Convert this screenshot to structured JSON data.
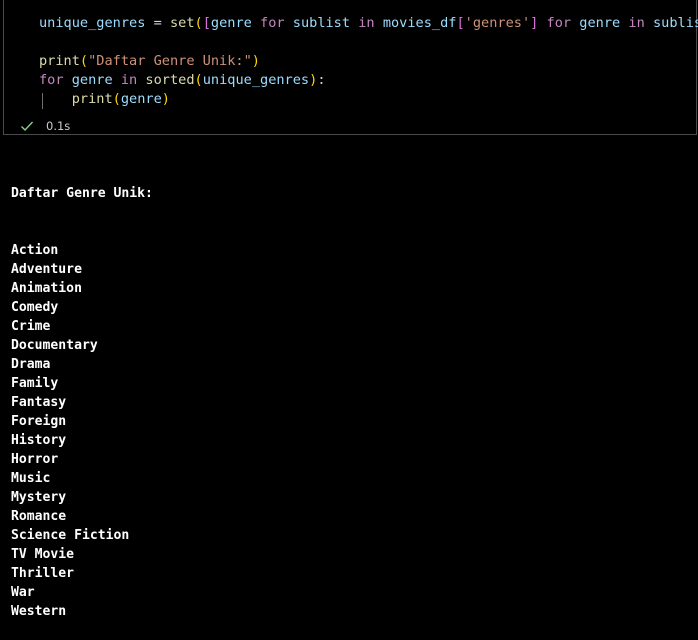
{
  "cell": {
    "code_lines": [
      [
        {
          "t": "unique_genres",
          "c": "var"
        },
        {
          "t": " = ",
          "c": "op"
        },
        {
          "t": "set",
          "c": "fn"
        },
        {
          "t": "(",
          "c": "br1"
        },
        {
          "t": "[",
          "c": "br2"
        },
        {
          "t": "genre",
          "c": "var"
        },
        {
          "t": " ",
          "c": "op"
        },
        {
          "t": "for",
          "c": "kw"
        },
        {
          "t": " ",
          "c": "op"
        },
        {
          "t": "sublist",
          "c": "var"
        },
        {
          "t": " ",
          "c": "op"
        },
        {
          "t": "in",
          "c": "kw"
        },
        {
          "t": " ",
          "c": "op"
        },
        {
          "t": "movies_df",
          "c": "var"
        },
        {
          "t": "[",
          "c": "br2"
        },
        {
          "t": "'genres'",
          "c": "str"
        },
        {
          "t": "]",
          "c": "br2"
        },
        {
          "t": " ",
          "c": "op"
        },
        {
          "t": "for",
          "c": "kw"
        },
        {
          "t": " ",
          "c": "op"
        },
        {
          "t": "genre",
          "c": "var"
        },
        {
          "t": " ",
          "c": "op"
        },
        {
          "t": "in",
          "c": "kw"
        },
        {
          "t": " ",
          "c": "op"
        },
        {
          "t": "sublist",
          "c": "var"
        },
        {
          "t": "]",
          "c": "br2"
        },
        {
          "t": ")",
          "c": "br1"
        }
      ],
      [],
      [
        {
          "t": "print",
          "c": "fn"
        },
        {
          "t": "(",
          "c": "br1"
        },
        {
          "t": "\"Daftar Genre Unik:\"",
          "c": "str"
        },
        {
          "t": ")",
          "c": "br1"
        }
      ],
      [
        {
          "t": "for",
          "c": "kw"
        },
        {
          "t": " ",
          "c": "op"
        },
        {
          "t": "genre",
          "c": "var"
        },
        {
          "t": " ",
          "c": "op"
        },
        {
          "t": "in",
          "c": "kw"
        },
        {
          "t": " ",
          "c": "op"
        },
        {
          "t": "sorted",
          "c": "fn"
        },
        {
          "t": "(",
          "c": "br1"
        },
        {
          "t": "unique_genres",
          "c": "var"
        },
        {
          "t": ")",
          "c": "br1"
        },
        {
          "t": ":",
          "c": "op"
        }
      ],
      [
        {
          "t": "    ",
          "c": "op"
        },
        {
          "t": "print",
          "c": "fn"
        },
        {
          "t": "(",
          "c": "br1"
        },
        {
          "t": "genre",
          "c": "var"
        },
        {
          "t": ")",
          "c": "br1"
        }
      ]
    ],
    "status": {
      "icon": "check-icon",
      "duration": "0.1s",
      "color": "#89d185"
    }
  },
  "output": {
    "heading": "Daftar Genre Unik:",
    "genres": [
      "Action",
      "Adventure",
      "Animation",
      "Comedy",
      "Crime",
      "Documentary",
      "Drama",
      "Family",
      "Fantasy",
      "Foreign",
      "History",
      "Horror",
      "Music",
      "Mystery",
      "Romance",
      "Science Fiction",
      "TV Movie",
      "Thriller",
      "War",
      "Western"
    ]
  }
}
